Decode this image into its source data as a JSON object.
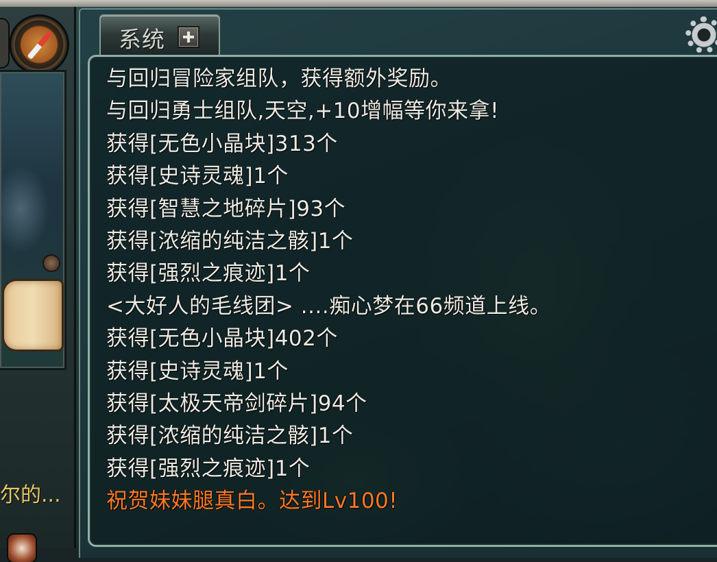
{
  "chat": {
    "tab_label": "系统",
    "messages": [
      {
        "text": "与回归冒险家组队，获得额外奖励。",
        "color": "#ecebe3"
      },
      {
        "text": "与回归勇士组队,天空,+10增幅等你来拿!",
        "color": "#ecebe3"
      },
      {
        "text": "获得[无色小晶块]313个",
        "color": "#ecebe3"
      },
      {
        "text": "获得[史诗灵魂]1个",
        "color": "#ecebe3"
      },
      {
        "text": "获得[智慧之地碎片]93个",
        "color": "#ecebe3"
      },
      {
        "text": "获得[浓缩的纯洁之骸]1个",
        "color": "#ecebe3"
      },
      {
        "text": "获得[强烈之痕迹]1个",
        "color": "#ecebe3"
      },
      {
        "text": "<大好人的毛线团> ....痴心梦在66频道上线。",
        "color": "#ecebe3"
      },
      {
        "text": "获得[无色小晶块]402个",
        "color": "#ecebe3"
      },
      {
        "text": "获得[史诗灵魂]1个",
        "color": "#ecebe3"
      },
      {
        "text": "获得[太极天帝剑碎片]94个",
        "color": "#ecebe3"
      },
      {
        "text": "获得[浓缩的纯洁之骸]1个",
        "color": "#ecebe3"
      },
      {
        "text": "获得[强烈之痕迹]1个",
        "color": "#ecebe3"
      },
      {
        "text": "祝贺妹妹腿真白。达到Lv100!",
        "color": "#ff7a26"
      }
    ]
  },
  "left_panel": {
    "truncated_text": "尔的..."
  },
  "icons": {
    "settings": "gear-icon",
    "add_tab": "plus-icon",
    "compass": "compass-icon",
    "scroll": "scroll-icon"
  }
}
